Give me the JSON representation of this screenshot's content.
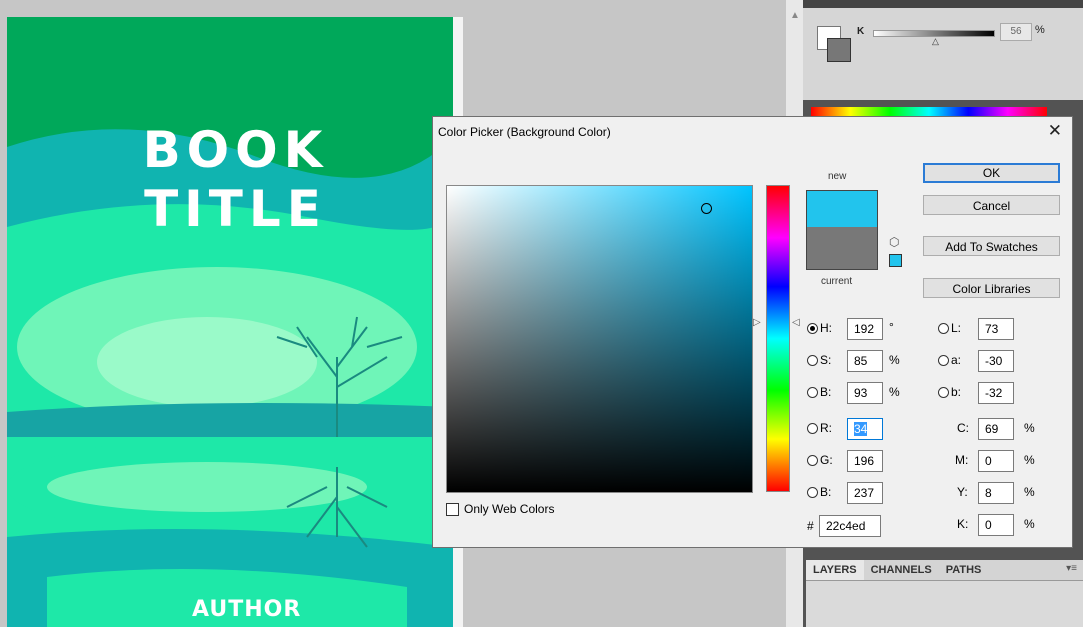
{
  "canvas": {
    "cover": {
      "title_line1": "BOOK",
      "title_line2": "TITLE",
      "author": "AUTHOR"
    }
  },
  "color_panel": {
    "channel": "K",
    "value": "56",
    "unit": "%"
  },
  "layers_panel": {
    "tabs": [
      "LAYERS",
      "CHANNELS",
      "PATHS"
    ]
  },
  "dialog": {
    "title": "Color Picker (Background Color)",
    "new_label": "new",
    "current_label": "current",
    "new_color": "#22c4ed",
    "current_color": "#787878",
    "buttons": {
      "ok": "OK",
      "cancel": "Cancel",
      "add_swatches": "Add To Swatches",
      "libraries": "Color Libraries"
    },
    "only_web_colors": "Only Web Colors",
    "hsb": {
      "h_label": "H:",
      "h": "192",
      "h_unit": "°",
      "s_label": "S:",
      "s": "85",
      "s_unit": "%",
      "b_label": "B:",
      "b": "93",
      "b_unit": "%"
    },
    "rgb": {
      "r_label": "R:",
      "r": "34",
      "g_label": "G:",
      "g": "196",
      "b_label": "B:",
      "b": "237"
    },
    "lab": {
      "l_label": "L:",
      "l": "73",
      "a_label": "a:",
      "a": "-30",
      "b_label": "b:",
      "b": "-32"
    },
    "cmyk": {
      "c_label": "C:",
      "c": "69",
      "m_label": "M:",
      "m": "0",
      "y_label": "Y:",
      "y": "8",
      "k_label": "K:",
      "k": "0",
      "unit": "%"
    },
    "hex_label": "#",
    "hex": "22c4ed"
  }
}
